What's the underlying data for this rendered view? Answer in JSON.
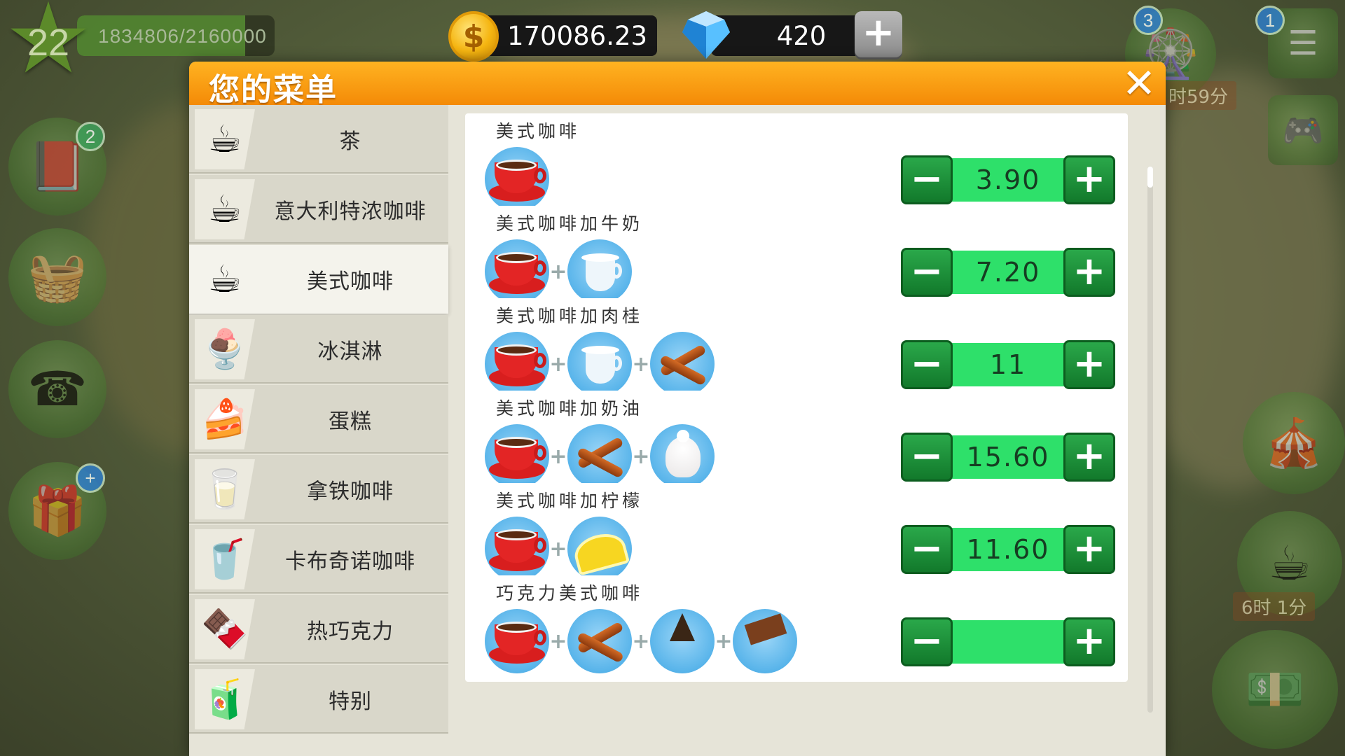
{
  "hud": {
    "level": "22",
    "xp_text": "1834806/2160000",
    "xp_progress": 0.85,
    "coins": "170086.23",
    "gems": "420",
    "add_label": "+"
  },
  "side": {
    "left_badges": [
      "2"
    ],
    "right_badges": [
      "3",
      "1"
    ],
    "timer_top": "时59分",
    "timer_bottom": "6时 1分"
  },
  "modal": {
    "title": "您的菜单",
    "close_label": "✕"
  },
  "categories": [
    {
      "label": "茶",
      "icon": "tea-cup-icon",
      "glyph": "☕"
    },
    {
      "label": "意大利特浓咖啡",
      "icon": "espresso-cup-icon",
      "glyph": "☕"
    },
    {
      "label": "美式咖啡",
      "icon": "american-coffee-icon",
      "glyph": "☕",
      "active": true
    },
    {
      "label": "冰淇淋",
      "icon": "ice-cream-icon",
      "glyph": "🍨"
    },
    {
      "label": "蛋糕",
      "icon": "cake-icon",
      "glyph": "🍰"
    },
    {
      "label": "拿铁咖啡",
      "icon": "latte-icon",
      "glyph": "🥛"
    },
    {
      "label": "卡布奇诺咖啡",
      "icon": "cappuccino-icon",
      "glyph": "🥤"
    },
    {
      "label": "热巧克力",
      "icon": "hot-chocolate-icon",
      "glyph": "🍫"
    },
    {
      "label": "特别",
      "icon": "special-icon",
      "glyph": "🧃"
    }
  ],
  "menu_items": [
    {
      "name": "美式咖啡",
      "price": "3.90",
      "ingredients": [
        "coffee-cup"
      ]
    },
    {
      "name": "美式咖啡加牛奶",
      "price": "7.20",
      "ingredients": [
        "coffee-cup",
        "milk"
      ]
    },
    {
      "name": "美式咖啡加肉桂",
      "price": "11",
      "ingredients": [
        "coffee-cup",
        "milk",
        "cinnamon"
      ]
    },
    {
      "name": "美式咖啡加奶油",
      "price": "15.60",
      "ingredients": [
        "coffee-cup",
        "cinnamon",
        "cream"
      ]
    },
    {
      "name": "美式咖啡加柠檬",
      "price": "11.60",
      "ingredients": [
        "coffee-cup",
        "lemon"
      ]
    },
    {
      "name": "巧克力美式咖啡",
      "price": "",
      "ingredients": [
        "coffee-cup",
        "cinnamon",
        "chocolate",
        "chocolate-bar"
      ]
    }
  ],
  "stepper": {
    "minus_label": "−",
    "plus_label": "+"
  },
  "colors": {
    "header": "#f48a07",
    "stepper": "#2ee06a",
    "stepper_button": "#12792b"
  }
}
